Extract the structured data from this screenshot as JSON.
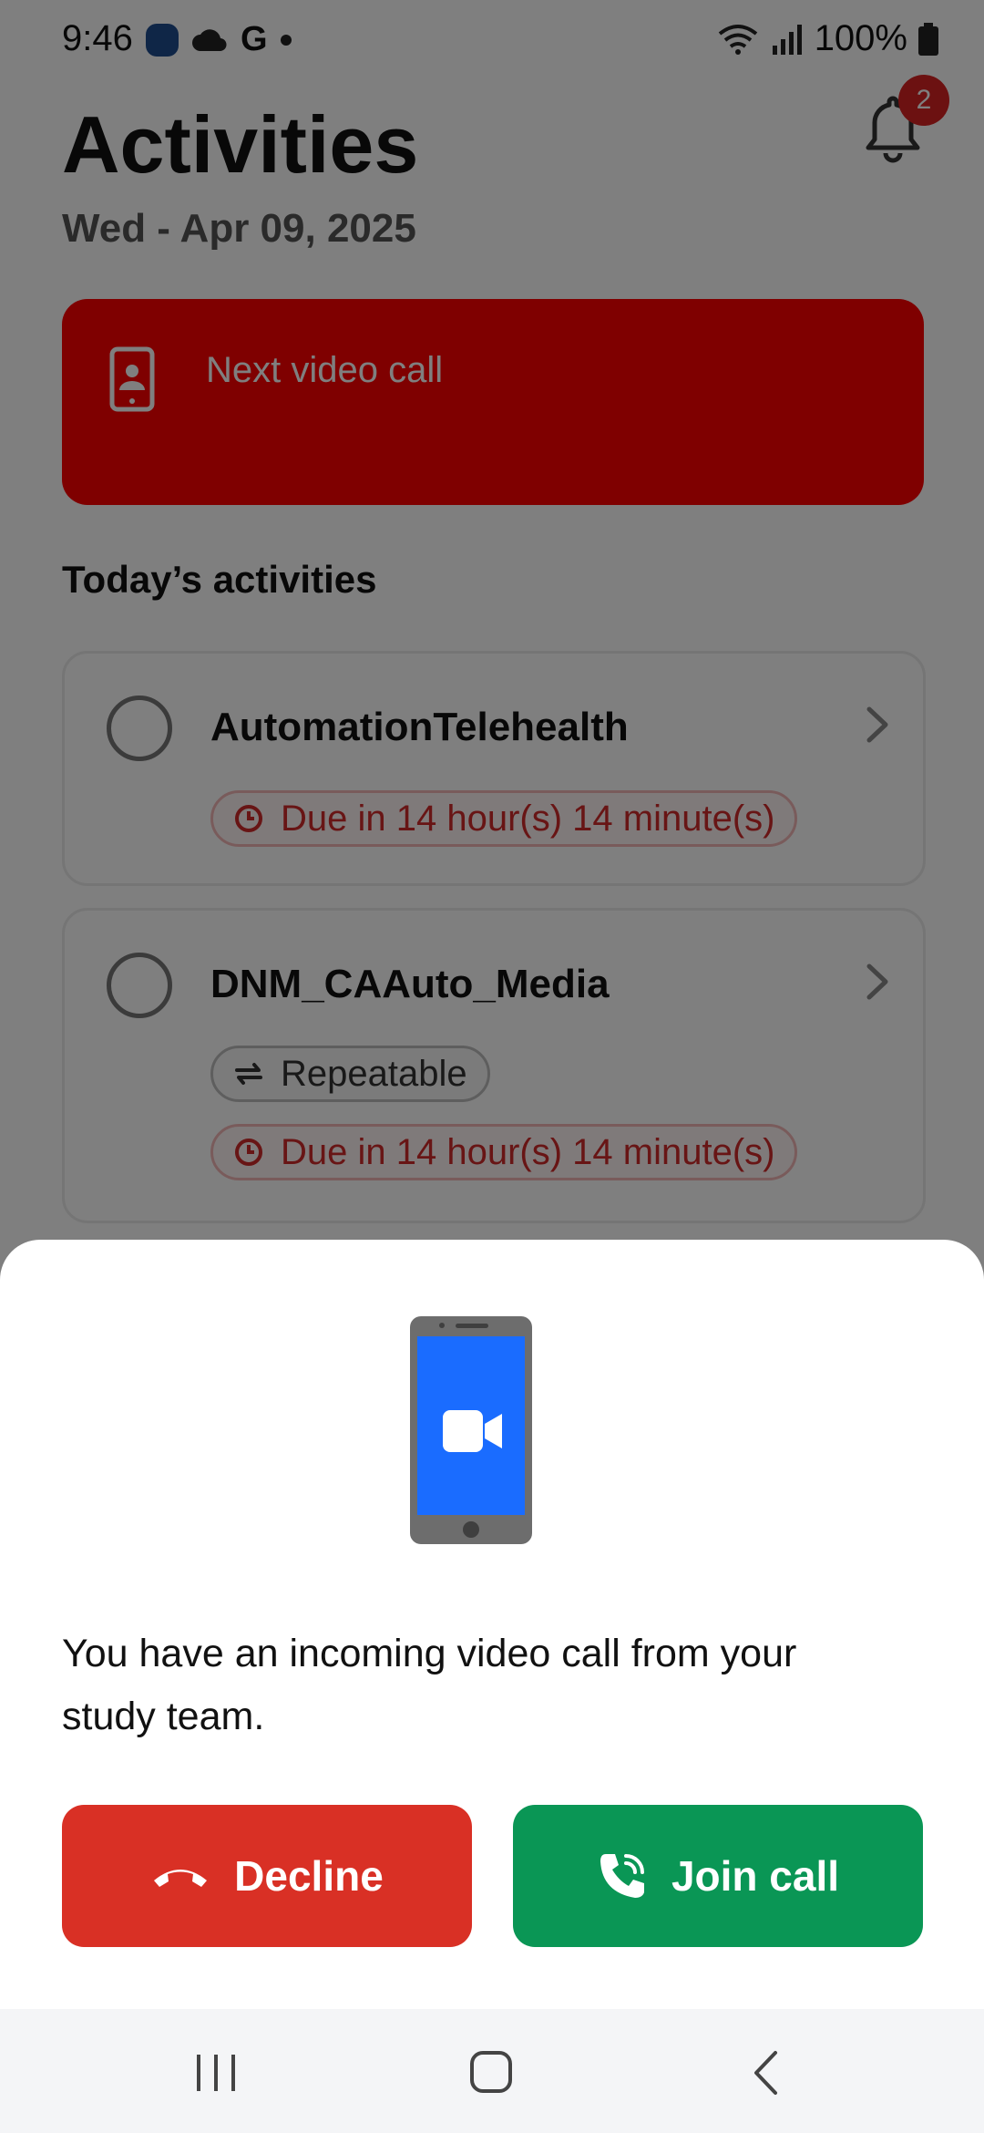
{
  "status_bar": {
    "time": "9:46",
    "battery": "100%"
  },
  "header": {
    "title": "Activities",
    "date": "Wed - Apr 09, 2025",
    "notifications_badge": "2"
  },
  "next_call": {
    "label": "Next video call",
    "color": "#ff0000"
  },
  "today": {
    "section_title": "Today’s activities",
    "activities": [
      {
        "title": "AutomationTelehealth",
        "due": "Due in 14 hour(s) 14 minute(s)"
      },
      {
        "title": "DNM_CAAuto_Media",
        "repeat": "Repeatable",
        "due": "Due in 14 hour(s) 14 minute(s)"
      }
    ]
  },
  "incoming_call": {
    "message": "You have an incoming video call from your study team.",
    "decline_label": "Decline",
    "join_label": "Join call",
    "decline_color": "#d93025",
    "join_color": "#0a9655"
  },
  "icons": [
    "bell-icon",
    "contact-phone-icon",
    "clock-icon",
    "repeat-icon",
    "chevron-right-icon",
    "phone-video-icon",
    "hang-up-icon",
    "phone-call-icon",
    "recents-icon",
    "home-icon",
    "back-icon"
  ]
}
